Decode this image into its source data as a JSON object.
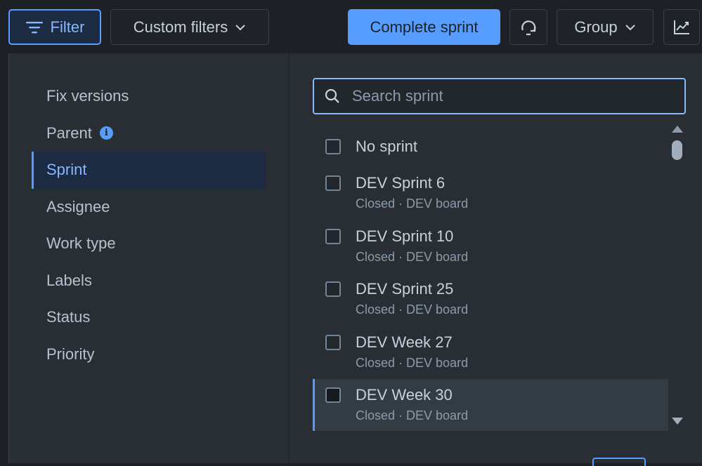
{
  "toolbar": {
    "filter_label": "Filter",
    "custom_filters_label": "Custom filters",
    "complete_sprint_label": "Complete sprint",
    "group_label": "Group"
  },
  "categories": [
    {
      "label": "Fix versions"
    },
    {
      "label": "Parent"
    },
    {
      "label": "Sprint"
    },
    {
      "label": "Assignee"
    },
    {
      "label": "Work type"
    },
    {
      "label": "Labels"
    },
    {
      "label": "Status"
    },
    {
      "label": "Priority"
    }
  ],
  "search": {
    "placeholder": "Search sprint",
    "value": ""
  },
  "sprints": [
    {
      "name": "No sprint",
      "meta": ""
    },
    {
      "name": "DEV Sprint 6",
      "meta": "Closed · DEV board"
    },
    {
      "name": "DEV Sprint 10",
      "meta": "Closed · DEV board"
    },
    {
      "name": "DEV Sprint 25",
      "meta": "Closed · DEV board"
    },
    {
      "name": "DEV Week 27",
      "meta": "Closed · DEV board"
    },
    {
      "name": "DEV Week 30",
      "meta": "Closed · DEV board"
    }
  ],
  "icons": {
    "filter": "filter-lines-icon",
    "chevron": "chevron-down-icon",
    "sync": "sync-icon",
    "insights": "line-chart-icon",
    "info": "info-icon",
    "search": "search-icon"
  },
  "colors": {
    "accent": "#579dff",
    "accent_text": "#85b8ff",
    "background": "#1d2125",
    "panel": "#282e33"
  }
}
